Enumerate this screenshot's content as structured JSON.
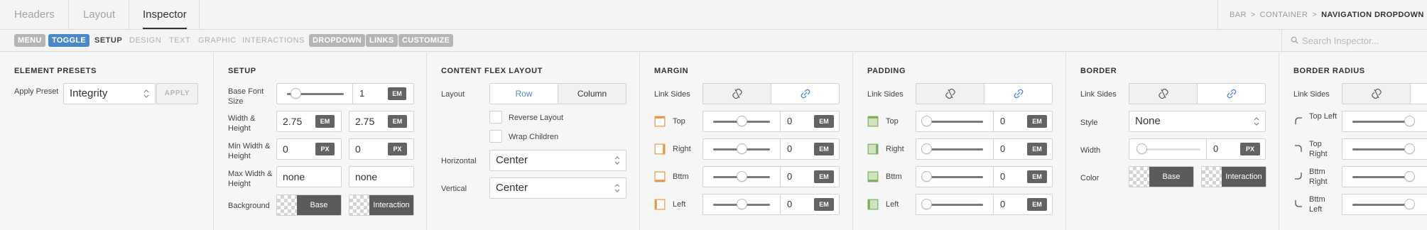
{
  "top_tabs": [
    "Headers",
    "Layout",
    "Inspector"
  ],
  "breadcrumb": [
    "BAR",
    "CONTAINER",
    "NAVIGATION DROPDOWN"
  ],
  "breadcrumb_sep": ">",
  "sub_tabs": {
    "menu": "MENU",
    "toggle": "TOGGLE",
    "setup": "SETUP",
    "design": "DESIGN",
    "text": "TEXT",
    "graphic": "GRAPHIC",
    "interactions": "INTERACTIONS",
    "dropdown": "DROPDOWN",
    "links": "LINKS",
    "customize": "CUSTOMIZE"
  },
  "search": {
    "placeholder": "Search Inspector..."
  },
  "presets": {
    "title": "ELEMENT PRESETS",
    "apply_label": "Apply Preset",
    "value": "Integrity",
    "apply_button": "APPLY"
  },
  "setup": {
    "title": "SETUP",
    "base_font_label": "Base Font Size",
    "base_font_value": "1",
    "base_font_level": 0.15,
    "size_label": "Width & Height",
    "width": "2.75",
    "height": "2.75",
    "min_label": "Min Width & Height",
    "min_width": "0",
    "min_height": "0",
    "max_label": "Max Width & Height",
    "max_width": "none",
    "max_height": "none",
    "background_label": "Background",
    "base": "Base",
    "interaction": "Interaction",
    "unit_em": "EM",
    "unit_px": "PX"
  },
  "flex": {
    "title": "CONTENT FLEX LAYOUT",
    "layout_label": "Layout",
    "row": "Row",
    "column": "Column",
    "reverse": "Reverse Layout",
    "wrap": "Wrap Children",
    "horizontal_label": "Horizontal",
    "horizontal": "Center",
    "vertical_label": "Vertical",
    "vertical": "Center"
  },
  "margin": {
    "title": "MARGIN",
    "link_label": "Link Sides",
    "sides": [
      {
        "label": "Top",
        "value": "0",
        "unit": "EM",
        "level": 0.5
      },
      {
        "label": "Right",
        "value": "0",
        "unit": "EM",
        "level": 0.5
      },
      {
        "label": "Bttm",
        "value": "0",
        "unit": "EM",
        "level": 0.5
      },
      {
        "label": "Left",
        "value": "0",
        "unit": "EM",
        "level": 0.5
      }
    ]
  },
  "padding": {
    "title": "PADDING",
    "link_label": "Link Sides",
    "sides": [
      {
        "label": "Top",
        "value": "0",
        "unit": "EM",
        "level": 0
      },
      {
        "label": "Right",
        "value": "0",
        "unit": "EM",
        "level": 0
      },
      {
        "label": "Bttm",
        "value": "0",
        "unit": "EM",
        "level": 0
      },
      {
        "label": "Left",
        "value": "0",
        "unit": "EM",
        "level": 0
      }
    ]
  },
  "border": {
    "title": "BORDER",
    "link_label": "Link Sides",
    "style_label": "Style",
    "style": "None",
    "width_label": "Width",
    "width": "0",
    "width_unit": "PX",
    "color_label": "Color",
    "base": "Base",
    "interaction": "Interaction"
  },
  "radius": {
    "title": "BORDER RADIUS",
    "link_label": "Link Sides",
    "corners": [
      {
        "label": "Top Left"
      },
      {
        "label": "Top Right"
      },
      {
        "label": "Bttm Right"
      },
      {
        "label": "Bttm Left"
      }
    ]
  },
  "colors": {
    "accent": "#4a89c8",
    "margin_icon": "#e8963c",
    "padding_icon": "#7cab5c",
    "chip": "#b5b5b5",
    "unit_badge": "#636363"
  }
}
